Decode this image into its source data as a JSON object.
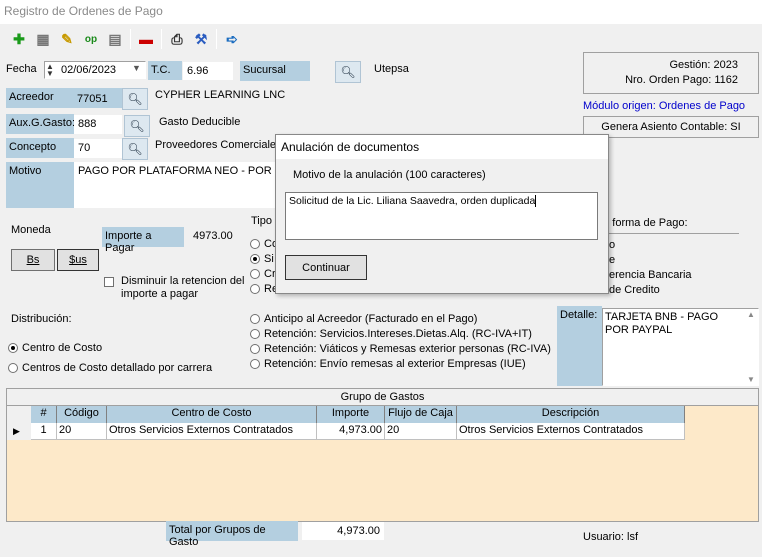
{
  "window": {
    "title": "Registro de Ordenes de Pago"
  },
  "toolbar": {
    "icons": [
      "add-icon",
      "copy-icon",
      "edit-icon",
      "approve-icon",
      "grid-icon",
      "delete-icon",
      "print-icon",
      "tools-icon",
      "exit-icon"
    ],
    "approve_text": "op"
  },
  "header": {
    "fecha_label": "Fecha",
    "fecha_value": "02/06/2023",
    "tc_label": "T.C.",
    "tc_value": "6.96",
    "sucursal_label": "Sucursal",
    "sucursal_value": "Utepsa",
    "gestion": "Gestión: 2023",
    "nro_orden": "Nro. Orden Pago: 1162",
    "modulo_origen": "Módulo origen: Ordenes de Pago",
    "genera_asiento": "Genera Asiento Contable: SI"
  },
  "acreedor": {
    "label": "Acreedor",
    "code": "77051",
    "name": "CYPHER LEARNING LNC"
  },
  "aux_gasto": {
    "label": "Aux.G.Gasto:",
    "code": "888",
    "name": "Gasto Deducible"
  },
  "concepto": {
    "label": "Concepto",
    "code": "70",
    "name": "Proveedores Comerciales"
  },
  "motivo": {
    "label": "Motivo",
    "value": "PAGO POR PLATAFORMA NEO - POR LA"
  },
  "moneda": {
    "label": "Moneda",
    "bs": "Bs",
    "us": "$us"
  },
  "importe": {
    "label": "Importe a Pagar",
    "value": "4973.00"
  },
  "disminuir_label": "Disminuir la retencion del importe a pagar",
  "tipo": {
    "label": "Tipo",
    "options": [
      "Co",
      "Si",
      "Cr",
      "Re"
    ],
    "selected": 1
  },
  "forma_pago": {
    "label": "de forma de Pago:",
    "options": [
      "o",
      "e",
      "erencia Bancaria",
      "de Credito"
    ]
  },
  "distribucion": {
    "label": "Distribución:",
    "options": [
      "Centro de Costo",
      "Centros de Costo detallado por carrera"
    ],
    "selected": 0
  },
  "retenciones": [
    "Anticipo al Acreedor (Facturado en el Pago)",
    "Retención: Servicios.Intereses.Dietas.Alq. (RC-IVA+IT)",
    "Retención: Viáticos y Remesas exterior personas (RC-IVA)",
    "Retención: Envío remesas al exterior Empresas (IUE)"
  ],
  "detalle": {
    "label": "Detalle:",
    "value": "TARJETA BNB - PAGO POR PAYPAL"
  },
  "grupo_gastos": {
    "title": "Grupo de Gastos",
    "columns": [
      "#",
      "Código",
      "Centro de Costo",
      "Importe",
      "Flujo de Caja",
      "Descripción"
    ],
    "rows": [
      [
        "1",
        "20",
        "Otros Servicios Externos Contratados",
        "4,973.00",
        "20",
        "Otros Servicios Externos Contratados"
      ]
    ]
  },
  "footer": {
    "total_label": "Total por Grupos de Gasto",
    "total_value": "4,973.00",
    "usuario": "Usuario: lsf"
  },
  "dialog": {
    "title": "Anulación de documentos",
    "prompt": "Motivo de la anulación (100 caracteres)",
    "value": "Solicitud de la Lic. Liliana Saavedra, orden duplicada",
    "button": "Continuar"
  },
  "colors": {
    "label_blue": "#b4cfe0",
    "highlight": "#fde9c9",
    "link_blue": "#0000cc"
  }
}
